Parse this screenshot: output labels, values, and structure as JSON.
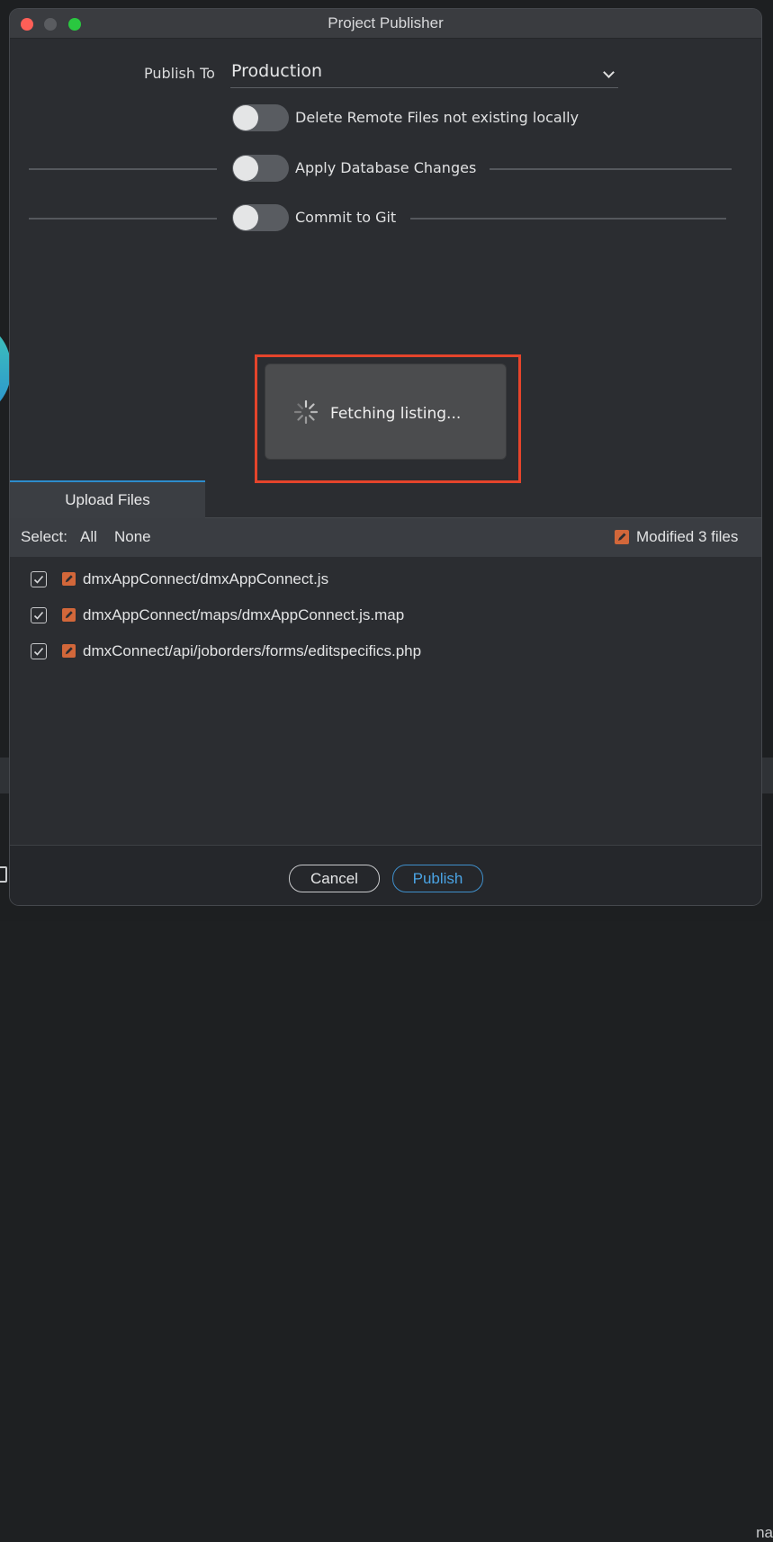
{
  "window": {
    "title": "Project Publisher"
  },
  "publish_to": {
    "label": "Publish To",
    "value": "Production"
  },
  "toggles": [
    {
      "label": "Delete Remote Files not existing locally",
      "on": false
    },
    {
      "label": "Apply Database Changes",
      "on": false
    },
    {
      "label": "Commit to Git",
      "on": false
    }
  ],
  "status": {
    "text": "Fetching listing..."
  },
  "tabs": [
    {
      "label": "Upload Files",
      "active": true
    }
  ],
  "selection": {
    "label": "Select:",
    "all": "All",
    "none": "None",
    "modified": "Modified 3 files"
  },
  "files": [
    {
      "path": "dmxAppConnect/dmxAppConnect.js",
      "checked": true
    },
    {
      "path": "dmxAppConnect/maps/dmxAppConnect.js.map",
      "checked": true
    },
    {
      "path": "dmxConnect/api/joborders/forms/editspecifics.php",
      "checked": true
    }
  ],
  "background": {
    "partial_text": "na"
  },
  "buttons": {
    "cancel": "Cancel",
    "publish": "Publish"
  },
  "colors": {
    "accent": "#2d8ccc",
    "highlight": "#e5442b",
    "modified": "#d2673a",
    "close": "#fe5f57",
    "maximize": "#2ac840"
  },
  "icons": {
    "modified": "pencil-badge-icon",
    "checkbox": "checkmark-icon",
    "spinner": "spinner-icon",
    "dropdown": "chevron-down-icon"
  }
}
